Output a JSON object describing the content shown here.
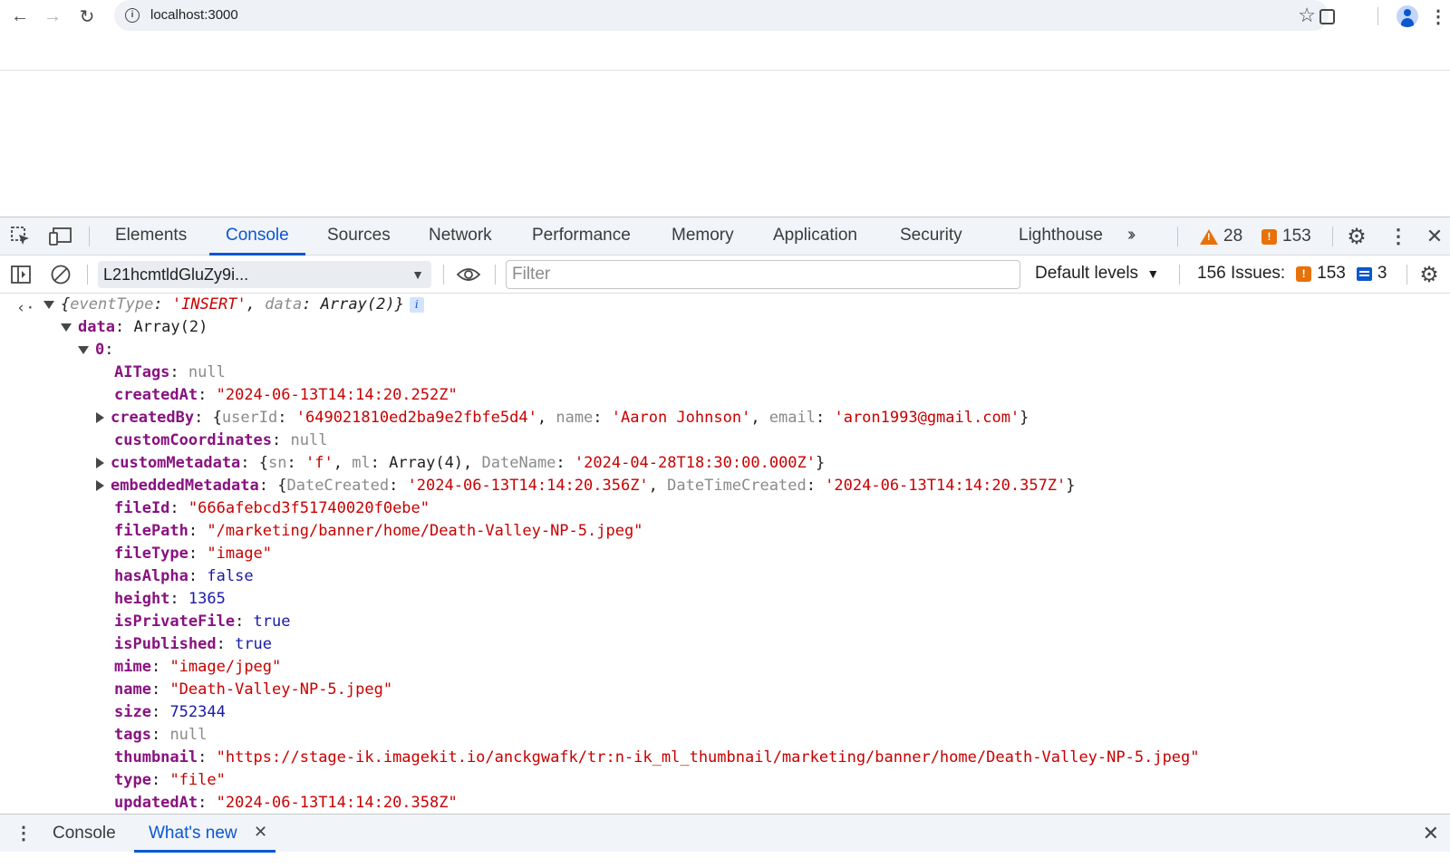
{
  "browser": {
    "url": "localhost:3000"
  },
  "devtools": {
    "tabs": [
      "Elements",
      "Console",
      "Sources",
      "Network",
      "Performance",
      "Memory",
      "Application",
      "Security",
      "Lighthouse"
    ],
    "active_tab": "Console",
    "warnings_count": "28",
    "errors_count": "153",
    "toolbar": {
      "context": "L21hcmtldGluZy9i...",
      "filter_placeholder": "Filter",
      "levels": "Default levels",
      "issues_label": "156 Issues:",
      "issues_errors": "153",
      "issues_info": "3"
    },
    "drawer": {
      "tabs": [
        "Console",
        "What's new"
      ],
      "active": "What's new"
    }
  },
  "console": {
    "summary": {
      "k1": "eventType",
      "v1": "'INSERT'",
      "k2": "data",
      "v2": "Array(2)"
    },
    "data_label": "data",
    "data_value": "Array(2)",
    "index_label": "0",
    "props": {
      "AITags": "null",
      "createdAt": "\"2024-06-13T14:14:20.252Z\"",
      "createdBy": {
        "userId": "'649021810ed2ba9e2fbfe5d4'",
        "name": "'Aaron Johnson'",
        "email": "'aron1993@gmail.com'"
      },
      "customCoordinates": "null",
      "customMetadata": {
        "sn": "'f'",
        "ml": "Array(4)",
        "DateName": "'2024-04-28T18:30:00.000Z'"
      },
      "embeddedMetadata": {
        "DateCreated": "'2024-06-13T14:14:20.356Z'",
        "DateTimeCreated": "'2024-06-13T14:14:20.357Z'"
      },
      "fileId": "\"666afebcd3f51740020f0ebe\"",
      "filePath": "\"/marketing/banner/home/Death-Valley-NP-5.jpeg\"",
      "fileType": "\"image\"",
      "hasAlpha": "false",
      "height": "1365",
      "isPrivateFile": "true",
      "isPublished": "true",
      "mime": "\"image/jpeg\"",
      "name": "\"Death-Valley-NP-5.jpeg\"",
      "size": "752344",
      "tags": "null",
      "thumbnail": "\"https://stage-ik.imagekit.io/anckgwafk/tr:n-ik_ml_thumbnail/marketing/banner/home/Death-Valley-NP-5.jpeg\"",
      "type": "\"file\"",
      "updatedAt": "\"2024-06-13T14:14:20.358Z\""
    }
  }
}
